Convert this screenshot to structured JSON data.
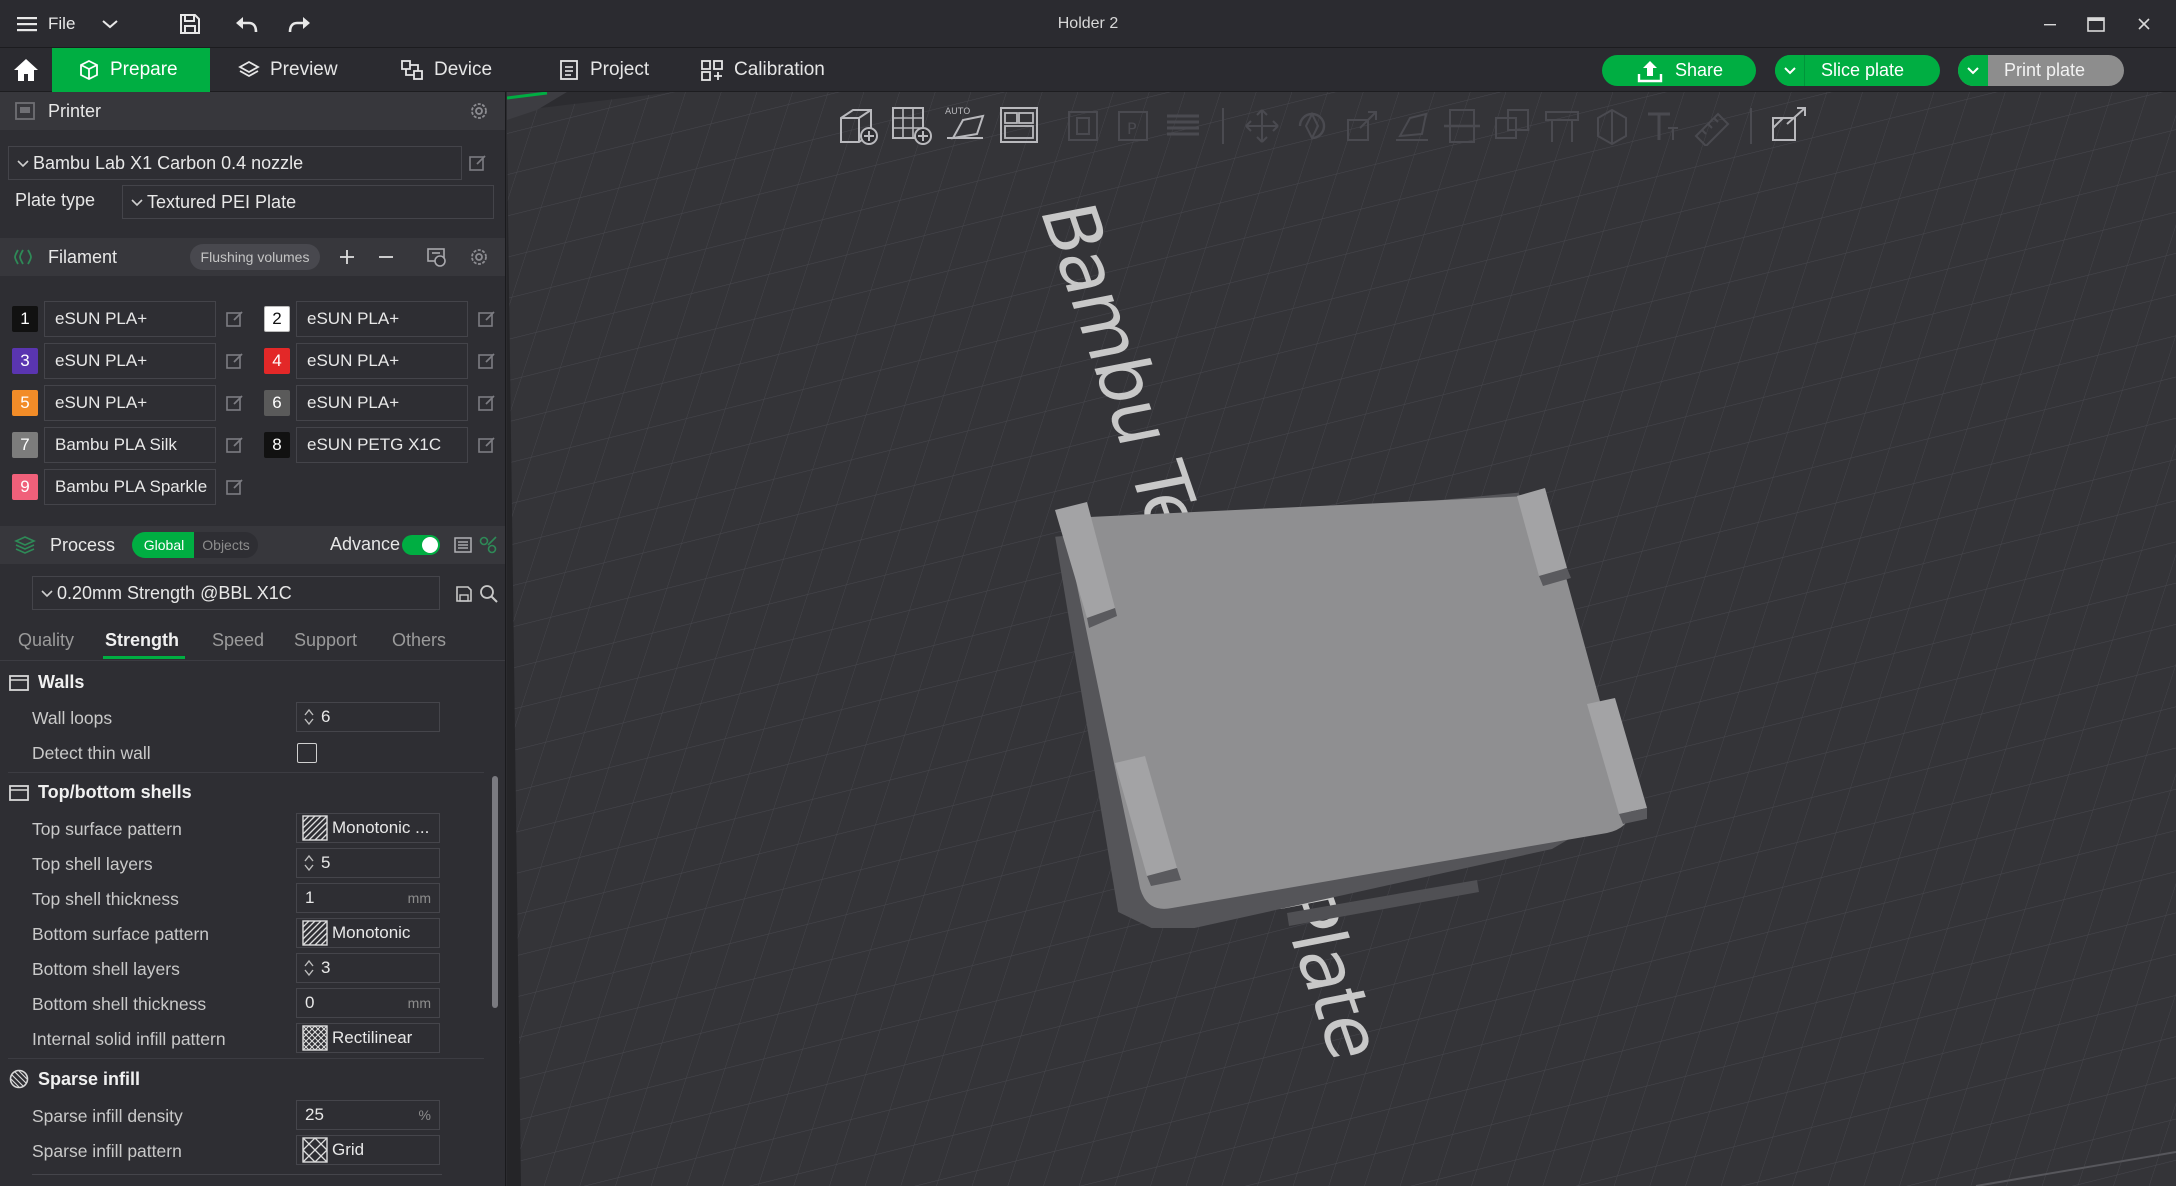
{
  "window": {
    "title": "Holder 2",
    "menu_label": "File"
  },
  "nav": {
    "tabs": [
      {
        "label": "Prepare",
        "active": true
      },
      {
        "label": "Preview"
      },
      {
        "label": "Device"
      },
      {
        "label": "Project"
      },
      {
        "label": "Calibration"
      }
    ],
    "share_label": "Share",
    "slice_label": "Slice plate",
    "print_label": "Print plate"
  },
  "printer": {
    "section_title": "Printer",
    "selected_printer": "Bambu Lab X1 Carbon 0.4 nozzle",
    "plate_type_label": "Plate type",
    "plate_type_value": "Textured PEI Plate"
  },
  "filament": {
    "section_title": "Filament",
    "flushing_label": "Flushing volumes",
    "items": [
      {
        "num": "1",
        "name": "eSUN PLA+",
        "color": "#111111",
        "text_color": "#ffffff"
      },
      {
        "num": "2",
        "name": "eSUN PLA+",
        "color": "#ffffff",
        "text_color": "#111111"
      },
      {
        "num": "3",
        "name": "eSUN PLA+",
        "color": "#5a35b0",
        "text_color": "#ffffff"
      },
      {
        "num": "4",
        "name": "eSUN PLA+",
        "color": "#e32828",
        "text_color": "#ffffff"
      },
      {
        "num": "5",
        "name": "eSUN PLA+",
        "color": "#f28c28",
        "text_color": "#ffffff"
      },
      {
        "num": "6",
        "name": "eSUN PLA+",
        "color": "#5a5a5a",
        "text_color": "#ffffff"
      },
      {
        "num": "7",
        "name": "Bambu PLA Silk",
        "color": "#7c7c7c",
        "text_color": "#ffffff"
      },
      {
        "num": "8",
        "name": "eSUN PETG X1C",
        "color": "#111111",
        "text_color": "#ffffff"
      },
      {
        "num": "9",
        "name": "Bambu PLA Sparkle",
        "color": "#f0607a",
        "text_color": "#ffffff"
      }
    ]
  },
  "process": {
    "section_title": "Process",
    "global_label": "Global",
    "objects_label": "Objects",
    "advance_label": "Advance",
    "advance_on": true,
    "preset": "0.20mm Strength @BBL X1C",
    "tabs": [
      "Quality",
      "Strength",
      "Speed",
      "Support",
      "Others"
    ],
    "active_tab": "Strength"
  },
  "settings": {
    "walls_title": "Walls",
    "wall_loops_label": "Wall loops",
    "wall_loops_value": "6",
    "detect_thin_wall_label": "Detect thin wall",
    "detect_thin_wall_checked": false,
    "top_bottom_title": "Top/bottom shells",
    "top_surface_pattern_label": "Top surface pattern",
    "top_surface_pattern_value": "Monotonic ...",
    "top_shell_layers_label": "Top shell layers",
    "top_shell_layers_value": "5",
    "top_shell_thickness_label": "Top shell thickness",
    "top_shell_thickness_value": "1",
    "bottom_surface_pattern_label": "Bottom surface pattern",
    "bottom_surface_pattern_value": "Monotonic",
    "bottom_shell_layers_label": "Bottom shell layers",
    "bottom_shell_layers_value": "3",
    "bottom_shell_thickness_label": "Bottom shell thickness",
    "bottom_shell_thickness_value": "0",
    "internal_solid_infill_label": "Internal solid infill pattern",
    "internal_solid_infill_value": "Rectilinear",
    "sparse_title": "Sparse infill",
    "sparse_density_label": "Sparse infill density",
    "sparse_density_value": "25",
    "sparse_pattern_label": "Sparse infill pattern",
    "sparse_pattern_value": "Grid",
    "unit_mm": "mm",
    "unit_percent": "%"
  },
  "viewport": {
    "plate_label": "Bambu Textured PEI Plate"
  },
  "colors": {
    "accent": "#00ae42",
    "panel": "#2e2e33",
    "viewport": "#2c2c30",
    "model": "#8f8f8f"
  }
}
